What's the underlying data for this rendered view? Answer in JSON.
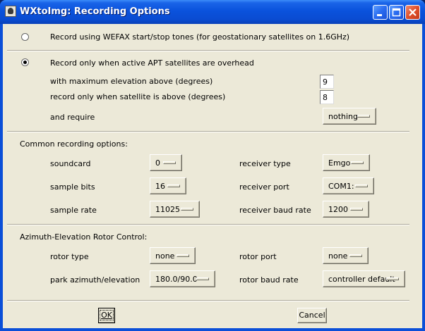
{
  "window": {
    "title": "WXtoImg: Recording Options"
  },
  "mode": {
    "wefax_label": "Record using WEFAX start/stop tones (for geostationary satellites on 1.6GHz)",
    "apt_label": "Record only when active APT satellites are overhead",
    "selected": "apt"
  },
  "apt": {
    "max_elev_label": "with maximum elevation above (degrees)",
    "max_elev_value": "9",
    "min_elev_label": "record only when satellite is above (degrees)",
    "min_elev_value": "8",
    "require_label": "and require",
    "require_value": "nothing"
  },
  "common": {
    "heading": "Common recording options:",
    "soundcard_label": "soundcard",
    "soundcard_value": "0",
    "bits_label": "sample bits",
    "bits_value": "16",
    "rate_label": "sample rate",
    "rate_value": "11025",
    "rxtype_label": "receiver type",
    "rxtype_value": "Emgo",
    "rxport_label": "receiver port",
    "rxport_value": "COM1:",
    "rxbaud_label": "receiver baud rate",
    "rxbaud_value": "1200"
  },
  "rotor": {
    "heading": "Azimuth-Elevation Rotor Control:",
    "type_label": "rotor type",
    "type_value": "none",
    "park_label": "park azimuth/elevation",
    "park_value": "180.0/90.0",
    "port_label": "rotor port",
    "port_value": "none",
    "baud_label": "rotor baud rate",
    "baud_value": "controller default"
  },
  "buttons": {
    "ok": "OK",
    "cancel": "Cancel"
  }
}
